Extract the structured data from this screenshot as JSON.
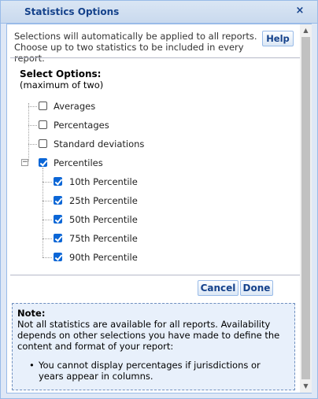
{
  "window": {
    "title": "Statistics Options",
    "close_glyph": "×"
  },
  "intro": {
    "line1": "Selections will automatically be applied to all reports.",
    "line2": "Choose up to two statistics to be included in every report.",
    "help_label": "Help"
  },
  "select": {
    "title": "Select Options:",
    "subtitle": "(maximum of two)"
  },
  "options": [
    {
      "label": "Averages",
      "checked": false
    },
    {
      "label": "Percentages",
      "checked": false
    },
    {
      "label": "Standard deviations",
      "checked": false
    },
    {
      "label": "Percentiles",
      "checked": true,
      "expanded": true
    }
  ],
  "percentiles": [
    {
      "label": "10th Percentile",
      "checked": true
    },
    {
      "label": "25th Percentile",
      "checked": true
    },
    {
      "label": "50th Percentile",
      "checked": true
    },
    {
      "label": "75th Percentile",
      "checked": true
    },
    {
      "label": "90th Percentile",
      "checked": true
    }
  ],
  "buttons": {
    "cancel": "Cancel",
    "done": "Done"
  },
  "note": {
    "title": "Note:",
    "body": "Not all statistics are available for all reports. Availability depends on other selections you have made to define the content and format of your report:",
    "bullet": "You cannot display percentages if jurisdictions or years appear in columns.",
    "bullet_glyph": "•"
  },
  "colors": {
    "title_text": "#15428b",
    "border": "#99bbe8",
    "checkbox_checked": "#0b66d6",
    "note_bg": "#e8f0fb"
  }
}
